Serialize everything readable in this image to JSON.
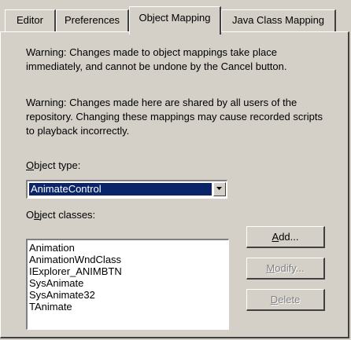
{
  "tabs": [
    {
      "label": "Editor",
      "active": false
    },
    {
      "label": "Preferences",
      "active": false
    },
    {
      "label": "Object Mapping",
      "active": true
    },
    {
      "label": "Java Class Mapping",
      "active": false
    }
  ],
  "warnings": {
    "first": "Warning:  Changes made to object mappings take place immediately, and cannot be undone by the Cancel button.",
    "second": "Warning: Changes made here are shared by all users of the repository.  Changing these mappings may cause recorded scripts to playback incorrectly."
  },
  "object_type": {
    "label_mnemonic": "O",
    "label_rest": "bject type:",
    "selected": "AnimateControl"
  },
  "object_classes": {
    "label_first": "O",
    "label_mnemonic": "b",
    "label_rest": "ject classes:",
    "items": [
      "Animation",
      "AnimationWndClass",
      "IExplorer_ANIMBTN",
      "SysAnimate",
      "SysAnimate32",
      "TAnimate"
    ]
  },
  "buttons": {
    "add": {
      "mnemonic": "A",
      "rest": "dd...",
      "enabled": true
    },
    "modify": {
      "mnemonic": "M",
      "rest": "odify...",
      "enabled": false
    },
    "delete": {
      "mnemonic": "D",
      "rest": "elete",
      "enabled": false
    }
  },
  "colors": {
    "face": "#d4d0c8",
    "highlight": "#0a246a",
    "disabled_text": "#808080"
  }
}
